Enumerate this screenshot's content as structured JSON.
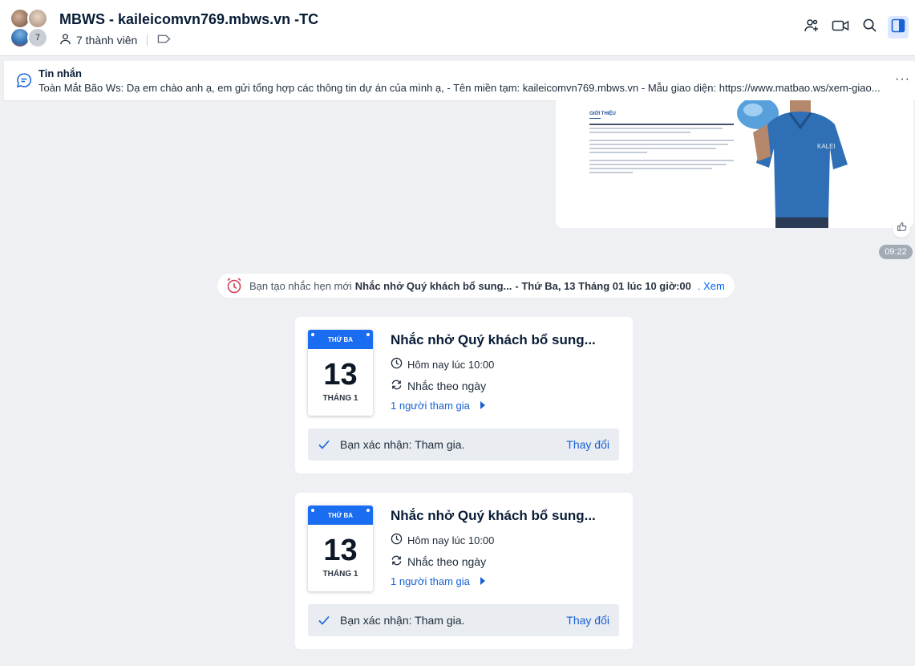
{
  "header": {
    "title": "MBWS - kaileicomvn769.mbws.vn -TC",
    "avatar_count": "7",
    "members": "7 thành viên"
  },
  "pinned": {
    "label": "Tin nhắn",
    "text": "Toàn Mắt Bão Ws: Dạ em chào anh ạ, em gửi tổng hợp các thông tin dự án của mình ạ, - Tên miền tạm: kaileicomvn769.mbws.vn - Mẫu giao diện: https://www.matbao.ws/xem-giao..."
  },
  "image_message": {
    "heading": "GIỚI THIỆU",
    "logo_text": "KALEI",
    "time": "09:22"
  },
  "notice": {
    "prefix": "Bạn tạo nhắc hẹn mới",
    "title": "Nhắc nhở Quý khách bổ sung...",
    "date": "- Thứ Ba, 13 Tháng 01 lúc 10 giờ:00",
    "link": ". Xem"
  },
  "cards": [
    {
      "weekday": "THỨ BA",
      "day": "13",
      "month": "THÁNG 1",
      "title": "Nhắc nhở Quý khách bổ sung...",
      "time": "Hôm nay lúc 10:00",
      "repeat": "Nhắc theo ngày",
      "participants": "1 người tham gia",
      "confirm": "Bạn xác nhận: Tham gia.",
      "change": "Thay đổi"
    },
    {
      "weekday": "THỨ BA",
      "day": "13",
      "month": "THÁNG 1",
      "title": "Nhắc nhở Quý khách bổ sung...",
      "time": "Hôm nay lúc 10:00",
      "repeat": "Nhắc theo ngày",
      "participants": "1 người tham gia",
      "confirm": "Bạn xác nhận: Tham gia.",
      "change": "Thay đổi"
    }
  ]
}
